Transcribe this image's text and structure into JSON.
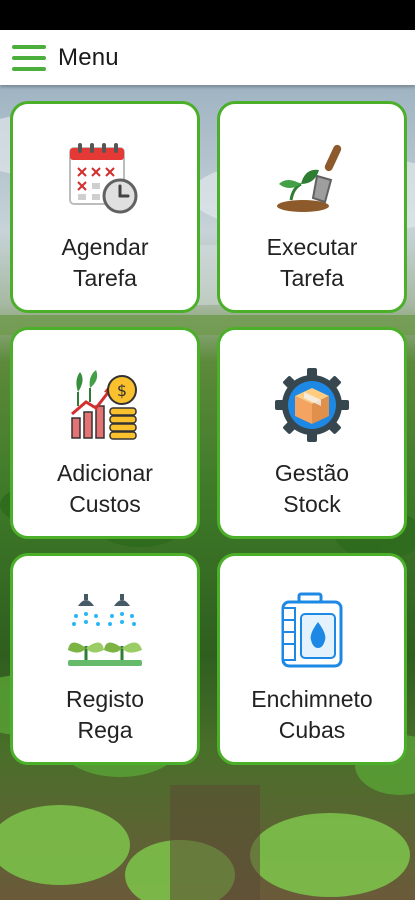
{
  "header": {
    "menu_label": "Menu"
  },
  "tiles": [
    {
      "line1": "Agendar",
      "line2": "Tarefa",
      "icon": "calendar-clock-icon"
    },
    {
      "line1": "Executar",
      "line2": "Tarefa",
      "icon": "plant-trowel-icon"
    },
    {
      "line1": "Adicionar",
      "line2": "Custos",
      "icon": "growth-coins-icon"
    },
    {
      "line1": "Gestão",
      "line2": "Stock",
      "icon": "box-gear-icon"
    },
    {
      "line1": "Registo",
      "line2": "Rega",
      "icon": "sprinkler-plants-icon"
    },
    {
      "line1": "Enchimneto",
      "line2": "Cubas",
      "icon": "tank-drop-icon"
    }
  ],
  "colors": {
    "accent": "#4caf2a",
    "tile_background": "#ffffff"
  }
}
